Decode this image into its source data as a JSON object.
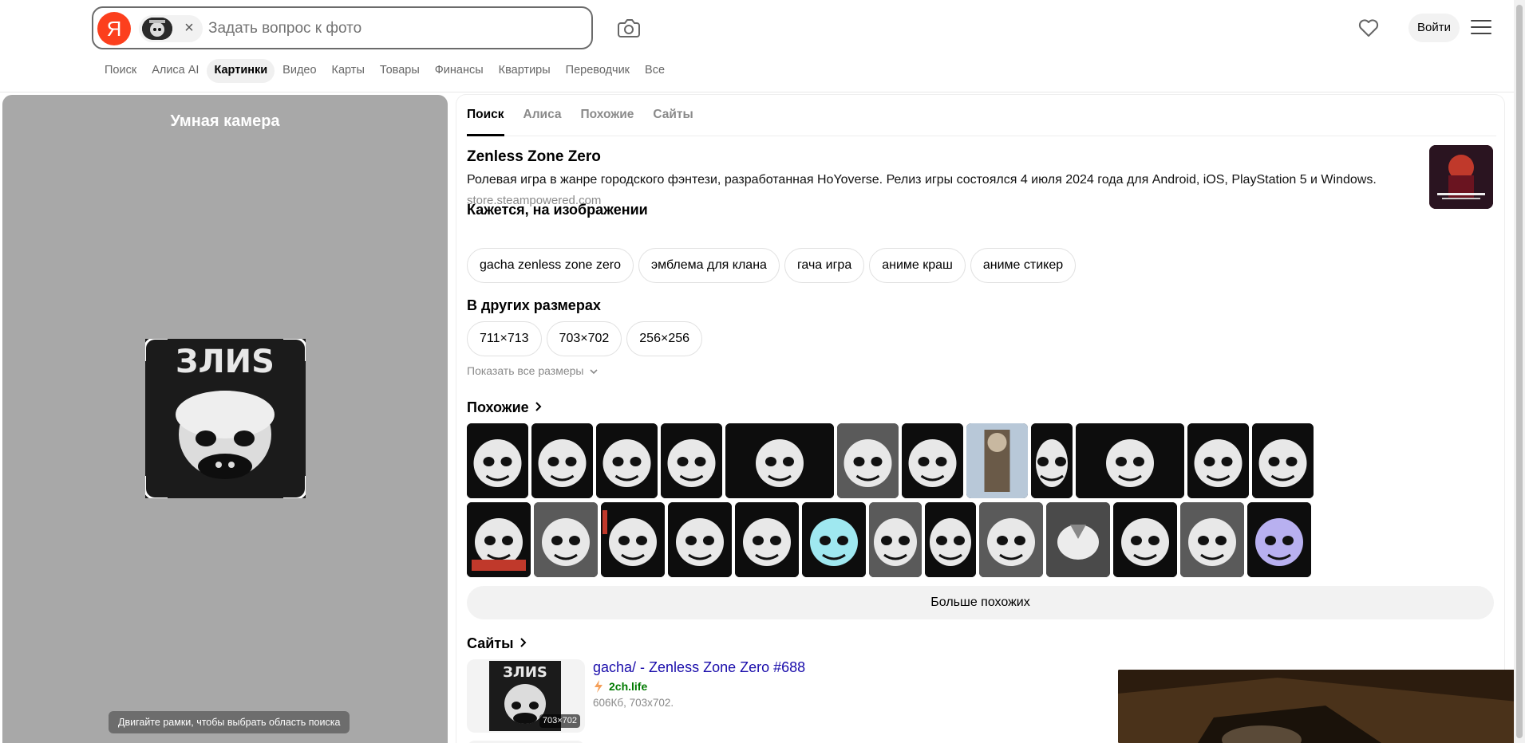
{
  "header": {
    "logo_letter": "Я",
    "search_placeholder": "Задать вопрос к фото",
    "login_label": "Войти",
    "services": [
      "Поиск",
      "Алиса AI",
      "Картинки",
      "Видео",
      "Карты",
      "Товары",
      "Финансы",
      "Квартиры",
      "Переводчик",
      "Все"
    ],
    "active_service": "Картинки",
    "brand_color": "#fc3f1d"
  },
  "left_panel": {
    "title": "Умная камера",
    "hint": "Двигайте рамки, чтобы выбрать область поиска",
    "image_caption": "ЗЛИЅ"
  },
  "tabs": [
    "Поиск",
    "Алиса",
    "Похожие",
    "Сайты"
  ],
  "active_tab": "Поиск",
  "entity": {
    "title": "Zenless Zone Zero",
    "description": "Ролевая игра в жанре городского фэнтези, разработанная HoYoverse. Релиз игры состоялся 4 июля 2024 года для Android, iOS, PlayStation 5 и Windows.",
    "source": "store.steampowered.com"
  },
  "seems_like": {
    "heading": "Кажется, на изображении",
    "tags": [
      "gacha zenless zone zero",
      "эмблема для клана",
      "гача игра",
      "аниме краш",
      "аниме стикер"
    ]
  },
  "other_sizes": {
    "heading": "В других размерах",
    "sizes": [
      "711×713",
      "703×702",
      "256×256"
    ],
    "show_all": "Показать все размеры"
  },
  "similar": {
    "heading": "Похожие",
    "row1": [
      "skull-girl",
      "tiger",
      "bulldog",
      "doberman",
      "skull-wide",
      "bulldog-grey",
      "bulldog-white",
      "zombie-figure",
      "skull-dark",
      "oni-wide",
      "skull-bow",
      "doberman-white"
    ],
    "row2": [
      "pudge",
      "skull-fist",
      "bulldog-red",
      "graffiti",
      "bulldog-cartoon",
      "doberman-cyan",
      "pitbull",
      "bowser",
      "bear",
      "airbender",
      "anime-girl",
      "demon-grey",
      "doberman-purple"
    ],
    "more_label": "Больше похожих"
  },
  "sites": {
    "heading": "Сайты",
    "items": [
      {
        "title": "gacha/ - Zenless Zone Zero #688",
        "domain": "2ch.life",
        "meta": "606Кб, 703x702.",
        "size_badge": "703×702"
      }
    ]
  }
}
